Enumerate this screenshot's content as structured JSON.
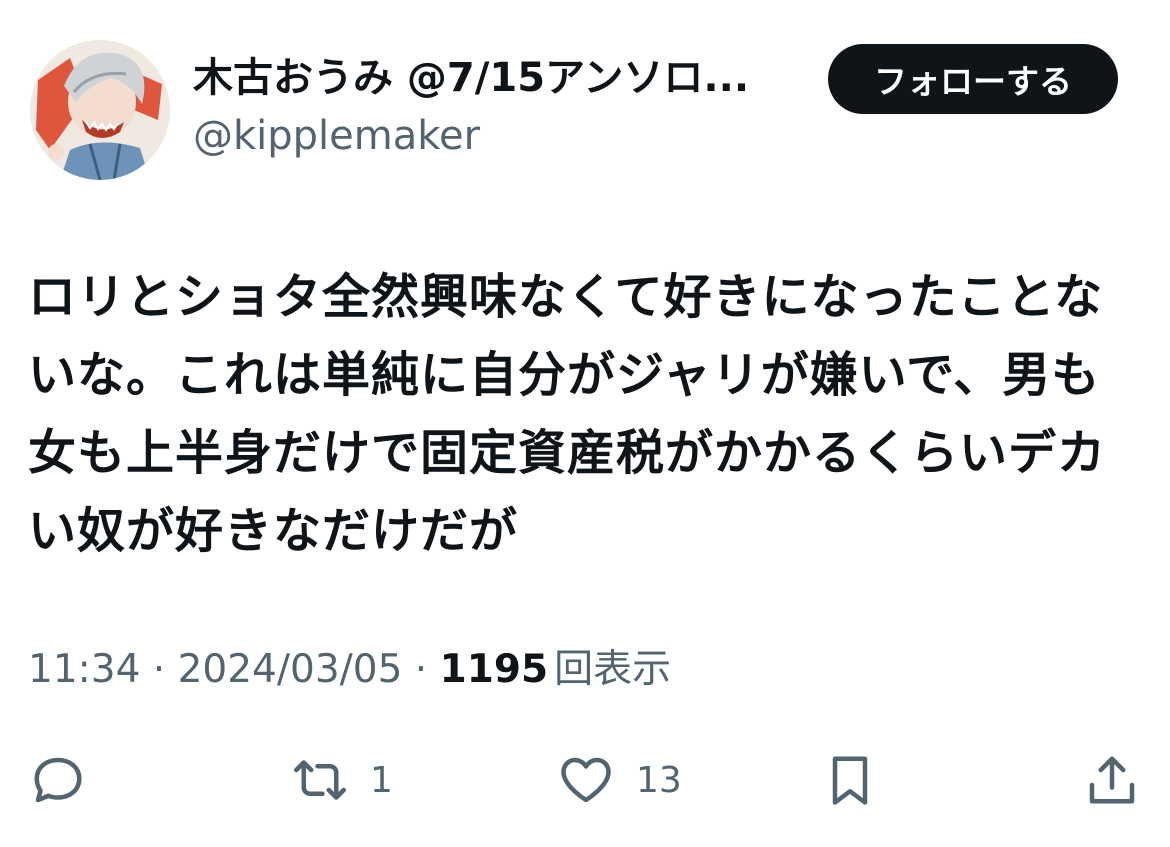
{
  "author": {
    "display_name": "木古おうみ @7/15アンソロ...",
    "handle": "@kipplemaker",
    "avatar_icon": "avatar-illustration"
  },
  "follow_button": {
    "label": "フォローする"
  },
  "tweet": {
    "text": "ロリとショタ全然興味なくて好きになったことないな。これは単純に自分がジャリが嫌いで、男も女も上半身だけで固定資産税がかかるくらいデカい奴が好きなだけだが"
  },
  "meta": {
    "time": "11:34",
    "separator1": " · ",
    "date": "2024/03/05",
    "separator2": " · ",
    "views_count": "1195",
    "views_label": "回表示"
  },
  "actions": {
    "reply": {
      "icon": "reply-icon",
      "count": ""
    },
    "retweet": {
      "icon": "retweet-icon",
      "count": "1"
    },
    "like": {
      "icon": "heart-icon",
      "count": "13"
    },
    "bookmark": {
      "icon": "bookmark-icon",
      "count": ""
    },
    "share": {
      "icon": "share-icon",
      "count": ""
    }
  },
  "colors": {
    "text": "#0f1419",
    "secondary": "#536471",
    "button_bg": "#0f1419",
    "background": "#ffffff"
  }
}
